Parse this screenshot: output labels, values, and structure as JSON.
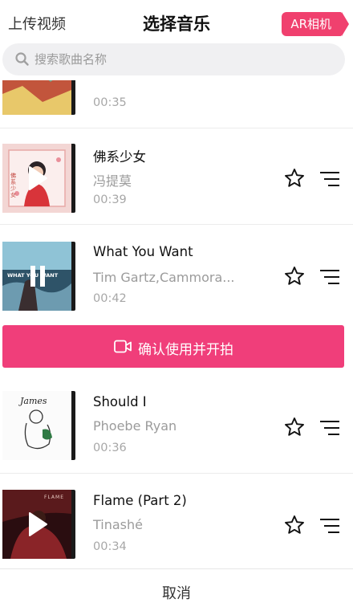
{
  "header": {
    "upload_label": "上传视频",
    "title": "选择音乐",
    "ar_label": "AR相机"
  },
  "search": {
    "placeholder": "搜索歌曲名称"
  },
  "songs": [
    {
      "title": "",
      "artist": "",
      "duration": "00:35",
      "state": "none"
    },
    {
      "title": "佛系少女",
      "artist": "冯提莫",
      "duration": "00:39",
      "state": "play"
    },
    {
      "title": "What You Want",
      "artist": "Tim Gartz,Cammora...",
      "duration": "00:42",
      "state": "pause"
    },
    {
      "title": "Should I",
      "artist": "Phoebe Ryan",
      "duration": "00:36",
      "state": "none"
    },
    {
      "title": "Flame (Part 2)",
      "artist": "Tinashé",
      "duration": "00:34",
      "state": "play"
    }
  ],
  "covers": {
    "song2_caption": "佛系少女",
    "song3_tag": "WHAT YOU WANT",
    "song4_tag": "James",
    "song5_tag": "FLAME"
  },
  "confirm_button": {
    "label": "确认使用并开拍"
  },
  "cancel_label": "取消",
  "icons": {
    "search": "search-icon",
    "favorite": "star-outline-icon",
    "menu": "list-menu-icon",
    "play": "play-icon",
    "pause": "pause-icon",
    "camera": "video-camera-icon"
  },
  "colors": {
    "accent": "#f03e7a",
    "ar_button": "#f0406e",
    "search_bg": "#f0f0f2"
  }
}
